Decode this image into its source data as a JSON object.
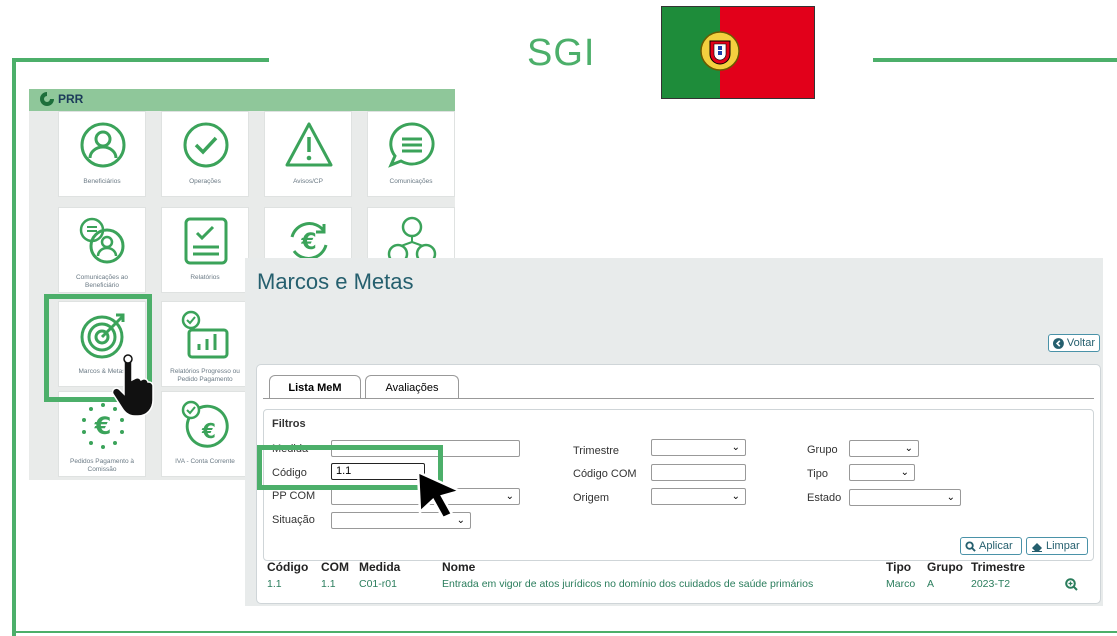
{
  "header": {
    "title": "SGI"
  },
  "left_app": {
    "logo_text": "PRR",
    "tiles": [
      {
        "label": "Beneficiários",
        "icon": "user-icon"
      },
      {
        "label": "Operações",
        "icon": "check-circle-icon"
      },
      {
        "label": "Avisos/CP",
        "icon": "warning-icon"
      },
      {
        "label": "Comunicações",
        "icon": "chat-icon"
      },
      {
        "label": "Comunicações ao Beneficiário",
        "icon": "user-chat-icon"
      },
      {
        "label": "Relatórios",
        "icon": "report-icon"
      },
      {
        "label": "",
        "icon": "euro-cycle-icon"
      },
      {
        "label": "",
        "icon": "users-network-icon"
      },
      {
        "label": "Marcos & Metas",
        "icon": "target-icon"
      },
      {
        "label": "Relatórios Progresso ou Pedido Pagamento",
        "icon": "chart-check-icon"
      },
      {
        "label": "Pedidos Pagamento à Comissão",
        "icon": "euro-stars-icon"
      },
      {
        "label": "IVA - Conta Corrente",
        "icon": "euro-check-icon"
      }
    ]
  },
  "panel": {
    "title": "Marcos e Metas",
    "back_label": "Voltar",
    "tabs": [
      {
        "label": "Lista MeM",
        "active": true
      },
      {
        "label": "Avaliações",
        "active": false
      }
    ],
    "filters": {
      "heading": "Filtros",
      "medida_label": "Medida",
      "codigo_label": "Código",
      "codigo_value": "1.1",
      "ppcom_label": "PP COM",
      "situacao_label": "Situação",
      "trimestre_label": "Trimestre",
      "codigo_com_label": "Código COM",
      "origem_label": "Origem",
      "grupo_label": "Grupo",
      "tipo_label": "Tipo",
      "estado_label": "Estado",
      "apply_label": "Aplicar",
      "clear_label": "Limpar"
    },
    "table": {
      "headers": [
        "Código",
        "COM",
        "Medida",
        "Nome",
        "Tipo",
        "Grupo",
        "Trimestre"
      ],
      "rows": [
        [
          "1.1",
          "1.1",
          "C01-r01",
          "Entrada em vigor de atos jurídicos no domínio dos cuidados de saúde primários",
          "Marco",
          "A",
          "2023-T2"
        ]
      ]
    }
  },
  "colors": {
    "accent": "#4caf6a",
    "title": "#255f6e",
    "link": "#2a7d5c"
  }
}
